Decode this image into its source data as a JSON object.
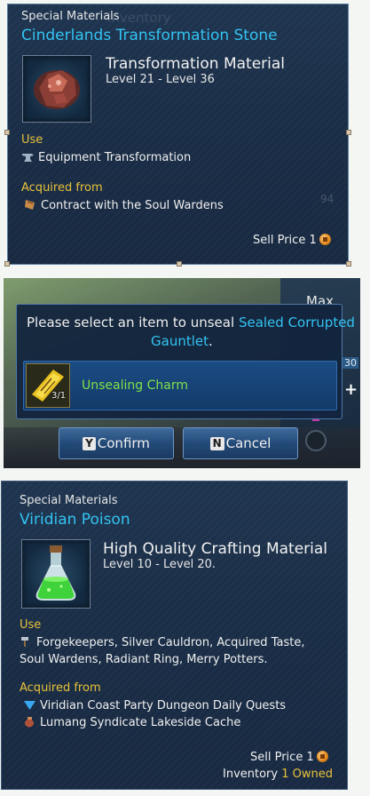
{
  "tooltip1": {
    "category": "Special Materials",
    "name": "Cinderlands Transformation Stone",
    "type_label": "Transformation Material",
    "level_range": "Level 21 - Level 36",
    "use_header": "Use",
    "use_items": [
      "Equipment Transformation"
    ],
    "acquired_header": "Acquired from",
    "acquired_items": [
      "Contract with the Soul Wardens"
    ],
    "sell_price_label": "Sell Price",
    "sell_price_value": "1",
    "bg_ghost_text": "Inventory",
    "bg_ghost_number": "94",
    "bg_ghost_small": "0"
  },
  "dialog": {
    "prompt_prefix": "Please select an item to unseal",
    "target_item_line1": "Sealed Corrupted",
    "target_item_line2": "Gauntlet",
    "period": ".",
    "slot_item_name": "Unsealing Charm",
    "slot_item_count": "3/1",
    "confirm_key": "Y",
    "confirm_label": "Confirm",
    "cancel_key": "N",
    "cancel_label": "Cancel",
    "corner_label": "Max",
    "side_number": "30"
  },
  "tooltip2": {
    "category": "Special Materials",
    "name": "Viridian Poison",
    "type_label": "High Quality Crafting Material",
    "level_range": "Level 10 - Level 20.",
    "use_header": "Use",
    "use_line1": "Forgekeepers, Silver Cauldron, Acquired Taste,",
    "use_line2": "Soul Wardens, Radiant Ring, Merry Potters.",
    "acquired_header": "Acquired from",
    "acquired_items": [
      "Viridian Coast Party Dungeon Daily Quests",
      "Lumang Syndicate Lakeside Cache"
    ],
    "sell_price_label": "Sell Price",
    "sell_price_value": "1",
    "inventory_label": "Inventory",
    "owned_value": "1 Owned"
  },
  "colors": {
    "item_name": "#33c3f2",
    "section_header": "#e8c23a",
    "panel_bg": "#1b2f48"
  },
  "icons": [
    "anvil-icon",
    "contract-icon",
    "ore-stone-icon",
    "charm-scroll-icon",
    "potion-flask-icon",
    "hammer-icon",
    "quest-arrow-icon",
    "cache-bag-icon",
    "gold-coin-icon"
  ]
}
